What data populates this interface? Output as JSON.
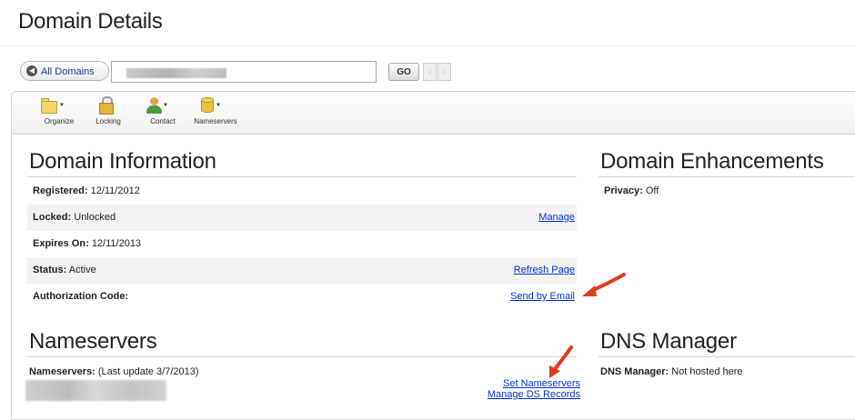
{
  "page": {
    "title": "Domain Details"
  },
  "search": {
    "all_domains_label": "All Domains",
    "go_label": "GO",
    "prev_glyph": "‹",
    "next_glyph": "›",
    "back_glyph": "◀"
  },
  "toolbar": {
    "tools": [
      {
        "label": "Organize",
        "icon": "folder-icon"
      },
      {
        "label": "Locking",
        "icon": "lock-icon"
      },
      {
        "label": "Contact",
        "icon": "contact-icon"
      },
      {
        "label": "Nameservers",
        "icon": "database-icon"
      }
    ]
  },
  "domain_info": {
    "title": "Domain Information",
    "rows": [
      {
        "label": "Registered:",
        "value": "12/11/2012",
        "link": ""
      },
      {
        "label": "Locked:",
        "value": "Unlocked",
        "link": "Manage"
      },
      {
        "label": "Expires On:",
        "value": "12/11/2013",
        "link": ""
      },
      {
        "label": "Status:",
        "value": "Active",
        "link": "Refresh Page"
      },
      {
        "label": "Authorization Code:",
        "value": "",
        "link": "Send by Email"
      }
    ]
  },
  "enhancements": {
    "title": "Domain Enhancements",
    "privacy_label": "Privacy:",
    "privacy_value": "Off"
  },
  "nameservers": {
    "title": "Nameservers",
    "label": "Nameservers:",
    "last_update": "(Last update 3/7/2013)",
    "set_link": "Set Nameservers",
    "ds_link": "Manage DS Records"
  },
  "dns": {
    "title": "DNS Manager",
    "label": "DNS Manager:",
    "value": "Not hosted here"
  },
  "colors": {
    "link": "#0033cc",
    "arrow": "#e03a1e",
    "row_shade": "#f2f2f2"
  }
}
